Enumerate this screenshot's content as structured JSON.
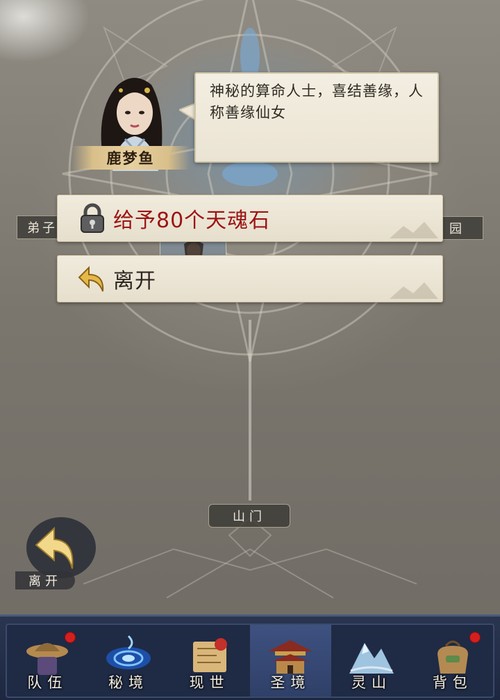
{
  "map": {
    "locations": {
      "left": "弟子",
      "right": "园",
      "gate": "山门"
    }
  },
  "npc": {
    "name": "鹿梦鱼",
    "description": "神秘的算命人士，喜结善缘，人称善缘仙女"
  },
  "dialog_options": [
    {
      "label": "给予80个天魂石",
      "icon": "lock-icon",
      "locked": true
    },
    {
      "label": "离开",
      "icon": "return-arrow-icon",
      "locked": false
    }
  ],
  "leave_button": {
    "label": "离开",
    "icon": "return-arrow-icon"
  },
  "nav": {
    "active": "圣境",
    "items": [
      {
        "label": "队伍",
        "icon": "team-icon",
        "badge": true
      },
      {
        "label": "秘境",
        "icon": "vortex-icon",
        "badge": false
      },
      {
        "label": "现世",
        "icon": "scroll-map-icon",
        "badge": false
      },
      {
        "label": "圣境",
        "icon": "palace-icon",
        "badge": false
      },
      {
        "label": "灵山",
        "icon": "mountain-icon",
        "badge": false
      },
      {
        "label": "背包",
        "icon": "bag-icon",
        "badge": true
      }
    ]
  },
  "colors": {
    "option_locked_text": "#9c1414",
    "nav_background": "#1f2a44",
    "nav_active": "#3e5180",
    "badge": "#d41f1f"
  }
}
